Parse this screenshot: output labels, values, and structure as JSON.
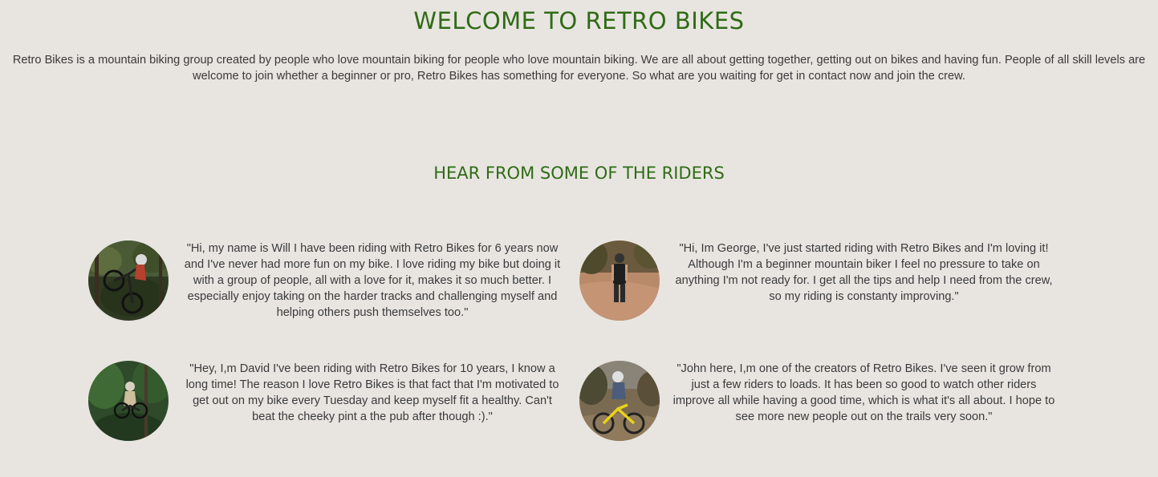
{
  "page": {
    "title": "WELCOME TO RETRO BIKES",
    "intro": "Retro Bikes is a mountain biking group created by people who love mountain biking for people who love mountain biking. We are all about getting together, getting out on bikes and having fun. People of all skill levels are welcome to join whether a beginner or pro, Retro Bikes has something for everyone. So what are you waiting for get in contact now and join the crew."
  },
  "riders_section": {
    "title": "HEAR FROM SOME OF THE RIDERS",
    "testimonials": [
      {
        "quote": "\"Hi, my name is Will I have been riding with Retro Bikes for 6 years now and I've never had more fun on my bike. I love riding my bike but doing it with a group of people, all with a love for it, makes it so much better. I especially enjoy taking on the harder tracks and challenging myself and helping others push themselves too.\"",
        "photo": "rider-jumping-in-forest-photo"
      },
      {
        "quote": "\"Hi, Im George, I've just started riding with Retro Bikes and I'm loving it! Although I'm a beginner mountain biker I feel no pressure to take on anything I'm not ready for. I get all the tips and help I need from the crew, so my riding is constanty improving.\"",
        "photo": "rider-standing-on-dirt-trail-photo"
      },
      {
        "quote": "\"Hey, I,m David I've been riding with Retro Bikes for 10 years, I know a long time! The reason I love Retro Bikes is that fact that I'm motivated to get out on my bike every Tuesday and keep myself fit a healthy. Can't beat the cheeky pint a the pub after though :).\"",
        "photo": "rider-airborne-among-trees-photo"
      },
      {
        "quote": "\"John here, I,m one of the creators of Retro Bikes. I've seen it grow from just a few riders to loads. It has been so good to watch other riders improve all while having a good time, which is what it's all about. I hope to see more new people out on the trails very soon.\"",
        "photo": "rider-on-yellow-bike-photo"
      }
    ]
  },
  "colors": {
    "background": "#e8e5e0",
    "heading_green": "#2f6b16",
    "body_text": "#3a3a3a"
  }
}
